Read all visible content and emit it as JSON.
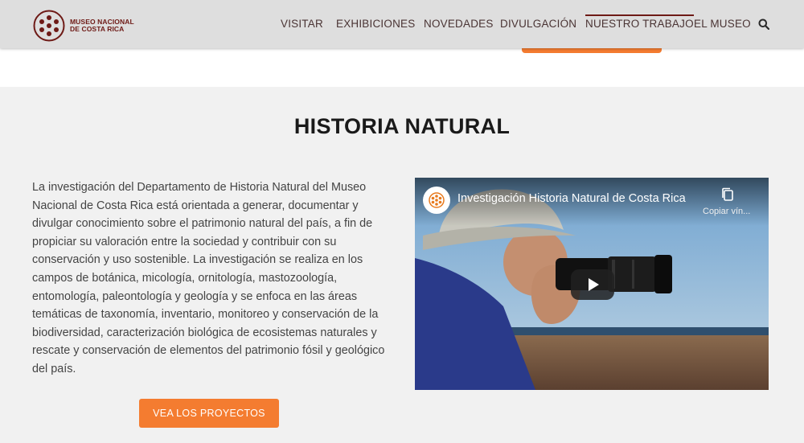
{
  "header": {
    "logo_text": "MUSEO NACIONAL DE COSTA RICA",
    "nav": [
      {
        "label": "VISITAR"
      },
      {
        "label": "EXHIBICIONES"
      },
      {
        "label": "NOVEDADES"
      },
      {
        "label": "DIVULGACIÓN"
      },
      {
        "label": "NUESTRO TRABAJO",
        "active": true
      },
      {
        "label": "EL MUSEO"
      }
    ],
    "search_icon": "search-icon"
  },
  "section": {
    "title": "HISTORIA NATURAL",
    "description": "La investigación del Departamento de Historia Natural del Museo Nacional de Costa Rica está orientada a generar, documentar y divulgar conocimiento sobre el patrimonio natural del país, a fin de propiciar su valoración entre la sociedad y contribuir con su conservación y uso sostenible. La investigación se realiza en los campos de botánica, micología, ornitología, mastozoología, entomología, paleontología y geología y se enfoca en las áreas temáticas de taxonomía, inventario, monitoreo y conservación de la biodiversidad, caracterización biológica de ecosistemas naturales y rescate y conservación de elementos del patrimonio fósil y geológico del país.",
    "button_label": "VEA LOS PROYECTOS"
  },
  "video": {
    "title": "Investigación Historia Natural de Costa Rica",
    "copy_label": "Copiar vín...",
    "play_icon": "play-icon",
    "copy_icon": "copy-icon"
  },
  "colors": {
    "brand": "#6e1a16",
    "accent": "#f47c30",
    "header_bg": "#dedede",
    "section_bg": "#f1f1f1"
  }
}
